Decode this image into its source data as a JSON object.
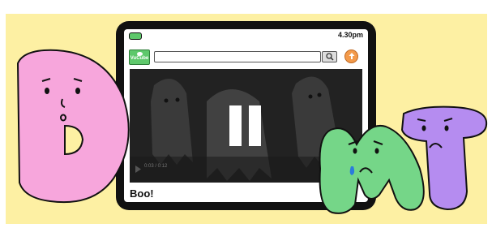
{
  "status_bar": {
    "time": "4.30pm"
  },
  "app": {
    "logo_text": "VuCube"
  },
  "search": {
    "placeholder": ""
  },
  "video": {
    "title": "Boo!",
    "state": "paused",
    "time_label": "0:03 / 0:12"
  },
  "icons": {
    "battery": "battery-icon",
    "search": "search-icon",
    "upload": "upload-icon",
    "pause": "pause-icon",
    "play": "play-icon"
  },
  "colors": {
    "background": "#fdf0a3",
    "letter_d": "#f7a6dc",
    "letter_m": "#75d688",
    "letter_t": "#b58cf0",
    "accent_green": "#5ec86b",
    "accent_orange": "#f39a4a"
  }
}
